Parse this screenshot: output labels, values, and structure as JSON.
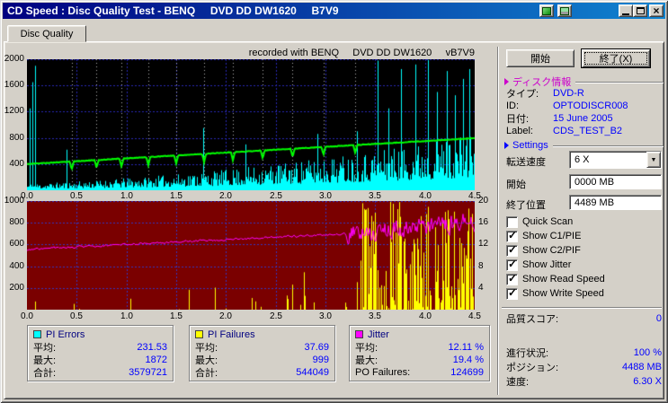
{
  "window": {
    "title": "CD Speed : Disc Quality Test - BENQ     DVD DD DW1620     B7V9"
  },
  "tab": {
    "label": "Disc Quality"
  },
  "chart_header": "recorded with BENQ     DVD DD DW1620     vB7V9",
  "buttons": {
    "start": "開始",
    "exit": "終了(X)"
  },
  "disc_info": {
    "header": "ディスク情報",
    "rows": [
      {
        "label": "タイプ:",
        "value": "DVD-R"
      },
      {
        "label": "ID:",
        "value": "OPTODISCR008"
      },
      {
        "label": "日付:",
        "value": "15 June 2005"
      },
      {
        "label": "Label:",
        "value": "CDS_TEST_B2"
      }
    ]
  },
  "settings": {
    "header": "Settings",
    "fields": [
      {
        "label": "転送速度",
        "value": "6 X",
        "type": "combo"
      },
      {
        "label": "開始",
        "value": "0000 MB",
        "type": "text"
      },
      {
        "label": "終了位置",
        "value": "4489 MB",
        "type": "text"
      }
    ],
    "checkboxes": [
      {
        "label": "Quick Scan",
        "checked": false
      },
      {
        "label": "Show C1/PIE",
        "checked": true
      },
      {
        "label": "Show C2/PIF",
        "checked": true
      },
      {
        "label": "Show Jitter",
        "checked": true
      },
      {
        "label": "Show Read Speed",
        "checked": true
      },
      {
        "label": "Show Write Speed",
        "checked": true
      }
    ]
  },
  "score": {
    "label": "品質スコア:",
    "value": "0"
  },
  "status": [
    {
      "label": "進行状況:",
      "value": "100 %"
    },
    {
      "label": "ポジション:",
      "value": "4488 MB"
    },
    {
      "label": "速度:",
      "value": "6.30 X"
    }
  ],
  "stat_boxes": [
    {
      "name": "PI Errors",
      "swatch": "#00ffff",
      "rows": [
        {
          "label": "平均:",
          "value": "231.53"
        },
        {
          "label": "最大:",
          "value": "1872"
        },
        {
          "label": "合計:",
          "value": "3579721"
        }
      ]
    },
    {
      "name": "PI Failures",
      "swatch": "#ffff00",
      "rows": [
        {
          "label": "平均:",
          "value": "37.69"
        },
        {
          "label": "最大:",
          "value": "999"
        },
        {
          "label": "合計:",
          "value": "544049"
        }
      ]
    },
    {
      "name": "Jitter",
      "swatch": "#ff00ff",
      "rows": [
        {
          "label": "平均:",
          "value": "12.11 %"
        },
        {
          "label": "最大:",
          "value": "19.4 %"
        },
        {
          "label": "PO Failures:",
          "value": "124699"
        }
      ]
    }
  ],
  "colors": {
    "header_magenta": "#cc00cc",
    "header_blue": "#0000ff",
    "value_blue": "#0000ff"
  },
  "chart_data": [
    {
      "type": "area",
      "name": "pie-error-rate-chart",
      "title": "recorded with BENQ DVD DD DW1620 vB7V9",
      "x_range": [
        0,
        4.5
      ],
      "y_range": [
        0,
        2000
      ],
      "x_ticks": [
        {
          "v": 0,
          "label": "0.0"
        },
        {
          "v": 0.5,
          "label": "0.5"
        },
        {
          "v": 1,
          "label": "1.0"
        },
        {
          "v": 1.5,
          "label": "1.5"
        },
        {
          "v": 2,
          "label": "2.0"
        },
        {
          "v": 2.5,
          "label": "2.5"
        },
        {
          "v": 3,
          "label": "3.0"
        },
        {
          "v": 3.5,
          "label": "3.5"
        },
        {
          "v": 4,
          "label": "4.0"
        },
        {
          "v": 4.5,
          "label": "4.5"
        }
      ],
      "y_ticks": [
        {
          "v": 2000,
          "label": "2000"
        },
        {
          "v": 1600,
          "label": "1600"
        },
        {
          "v": 1200,
          "label": "1200"
        },
        {
          "v": 800,
          "label": "800"
        },
        {
          "v": 400,
          "label": "400"
        }
      ],
      "bg": "#000000",
      "grid_color": "#2828b4",
      "grid_x": [
        0.5,
        1,
        1.5,
        2,
        2.5,
        3,
        3.5,
        4
      ],
      "grid_y": [
        400,
        800,
        1200,
        1600,
        2000
      ],
      "markers": {
        "color": "#b0b0b0",
        "positions": [
          0.45,
          0.7,
          0.95,
          1.22,
          1.5,
          1.78,
          2.07,
          2.37,
          2.67,
          2.98,
          3.3
        ]
      },
      "series": [
        {
          "name": "C1/PIE",
          "kind": "spikes",
          "color": "#00ffff",
          "seed": 11,
          "base": [
            100,
            60,
            25
          ],
          "min_frac": 0.22,
          "pow": 1.4,
          "spikes": [
            [
              0.03,
              1250
            ],
            [
              0.055,
              1650
            ],
            [
              0.08,
              1900
            ],
            [
              0.4,
              620
            ],
            [
              1.77,
              950
            ],
            [
              2.2,
              700
            ],
            [
              2.92,
              860
            ],
            [
              3.32,
              900
            ],
            [
              3.52,
              1980
            ],
            [
              3.63,
              1250
            ],
            [
              3.76,
              1850
            ],
            [
              3.9,
              1920
            ],
            [
              4.03,
              1990
            ],
            [
              4.12,
              1500
            ],
            [
              4.22,
              1820
            ],
            [
              4.3,
              1450
            ],
            [
              4.38,
              1700
            ],
            [
              4.45,
              1850
            ]
          ]
        },
        {
          "name": "Read Speed",
          "kind": "trendline",
          "color": "#00ff00",
          "width": 2,
          "seed": 5,
          "start": 400,
          "end": 795,
          "noise": 5,
          "dips": [
            0.45,
            0.7,
            0.95,
            1.22,
            1.5,
            1.78,
            2.07,
            2.37,
            2.67,
            2.98,
            3.3
          ],
          "dip_depth": 125,
          "dip_width": 0.02
        }
      ],
      "summary": {
        "pie_avg": 231.53,
        "pie_max": 1872,
        "pie_total": 3579721
      }
    },
    {
      "type": "area",
      "name": "pif-jitter-chart",
      "x_range": [
        0,
        4.5
      ],
      "y_range": [
        0,
        1000
      ],
      "y_range_right": [
        0,
        20
      ],
      "x_ticks": [
        {
          "v": 0,
          "label": "0.0"
        },
        {
          "v": 0.5,
          "label": "0.5"
        },
        {
          "v": 1,
          "label": "1.0"
        },
        {
          "v": 1.5,
          "label": "1.5"
        },
        {
          "v": 2,
          "label": "2.0"
        },
        {
          "v": 2.5,
          "label": "2.5"
        },
        {
          "v": 3,
          "label": "3.0"
        },
        {
          "v": 3.5,
          "label": "3.5"
        },
        {
          "v": 4,
          "label": "4.0"
        },
        {
          "v": 4.5,
          "label": "4.5"
        }
      ],
      "y_ticks": [
        {
          "v": 1000,
          "label": "1000"
        },
        {
          "v": 800,
          "label": "800"
        },
        {
          "v": 600,
          "label": "600"
        },
        {
          "v": 400,
          "label": "400"
        },
        {
          "v": 200,
          "label": "200"
        }
      ],
      "y_ticks_right": [
        {
          "v": 20,
          "label": "20"
        },
        {
          "v": 16,
          "label": "16"
        },
        {
          "v": 12,
          "label": "12"
        },
        {
          "v": 8,
          "label": "8"
        },
        {
          "v": 4,
          "label": "4"
        }
      ],
      "bg": "#7a0000",
      "grid_color": "#3434c0",
      "grid_x": [
        0.5,
        1,
        1.5,
        2,
        2.5,
        3,
        3.5,
        4
      ],
      "grid_y": [
        200,
        400,
        600,
        800,
        1000
      ],
      "series": [
        {
          "name": "C2/PIF",
          "kind": "randspikes",
          "color": "#ffff00",
          "seed": 23,
          "zones": [
            {
              "t_end": 1.4,
              "p": 0.015,
              "hmax": 140,
              "hpow": 1.8
            },
            {
              "t_end": 2.6,
              "p": 0.05,
              "hmax": 220,
              "hpow": 1.8
            },
            {
              "t_end": 3.35,
              "p": 0.13,
              "hmax": 380,
              "hpow": 1.6
            },
            {
              "t_end": 4.5,
              "p": 0.82,
              "hmax": 999,
              "hpow": 1.15
            }
          ]
        },
        {
          "name": "Jitter",
          "kind": "jitterline",
          "color": "#ff00ff",
          "width": 1,
          "seed": 9,
          "segments": [
            {
              "t0": 0,
              "t1": 3.2,
              "v0": 555,
              "v1": 700,
              "noise": 14
            },
            {
              "t0": 3.2,
              "t1": 4.5,
              "v0": 700,
              "v1": 810,
              "noise": 130
            }
          ],
          "clamp": [
            380,
            975
          ]
        }
      ],
      "summary": {
        "jitter_avg_pct": 12.11,
        "jitter_max_pct": 19.4,
        "pif_avg": 37.69,
        "pif_max": 999,
        "pif_total": 544049,
        "po_failures": 124699
      }
    }
  ]
}
